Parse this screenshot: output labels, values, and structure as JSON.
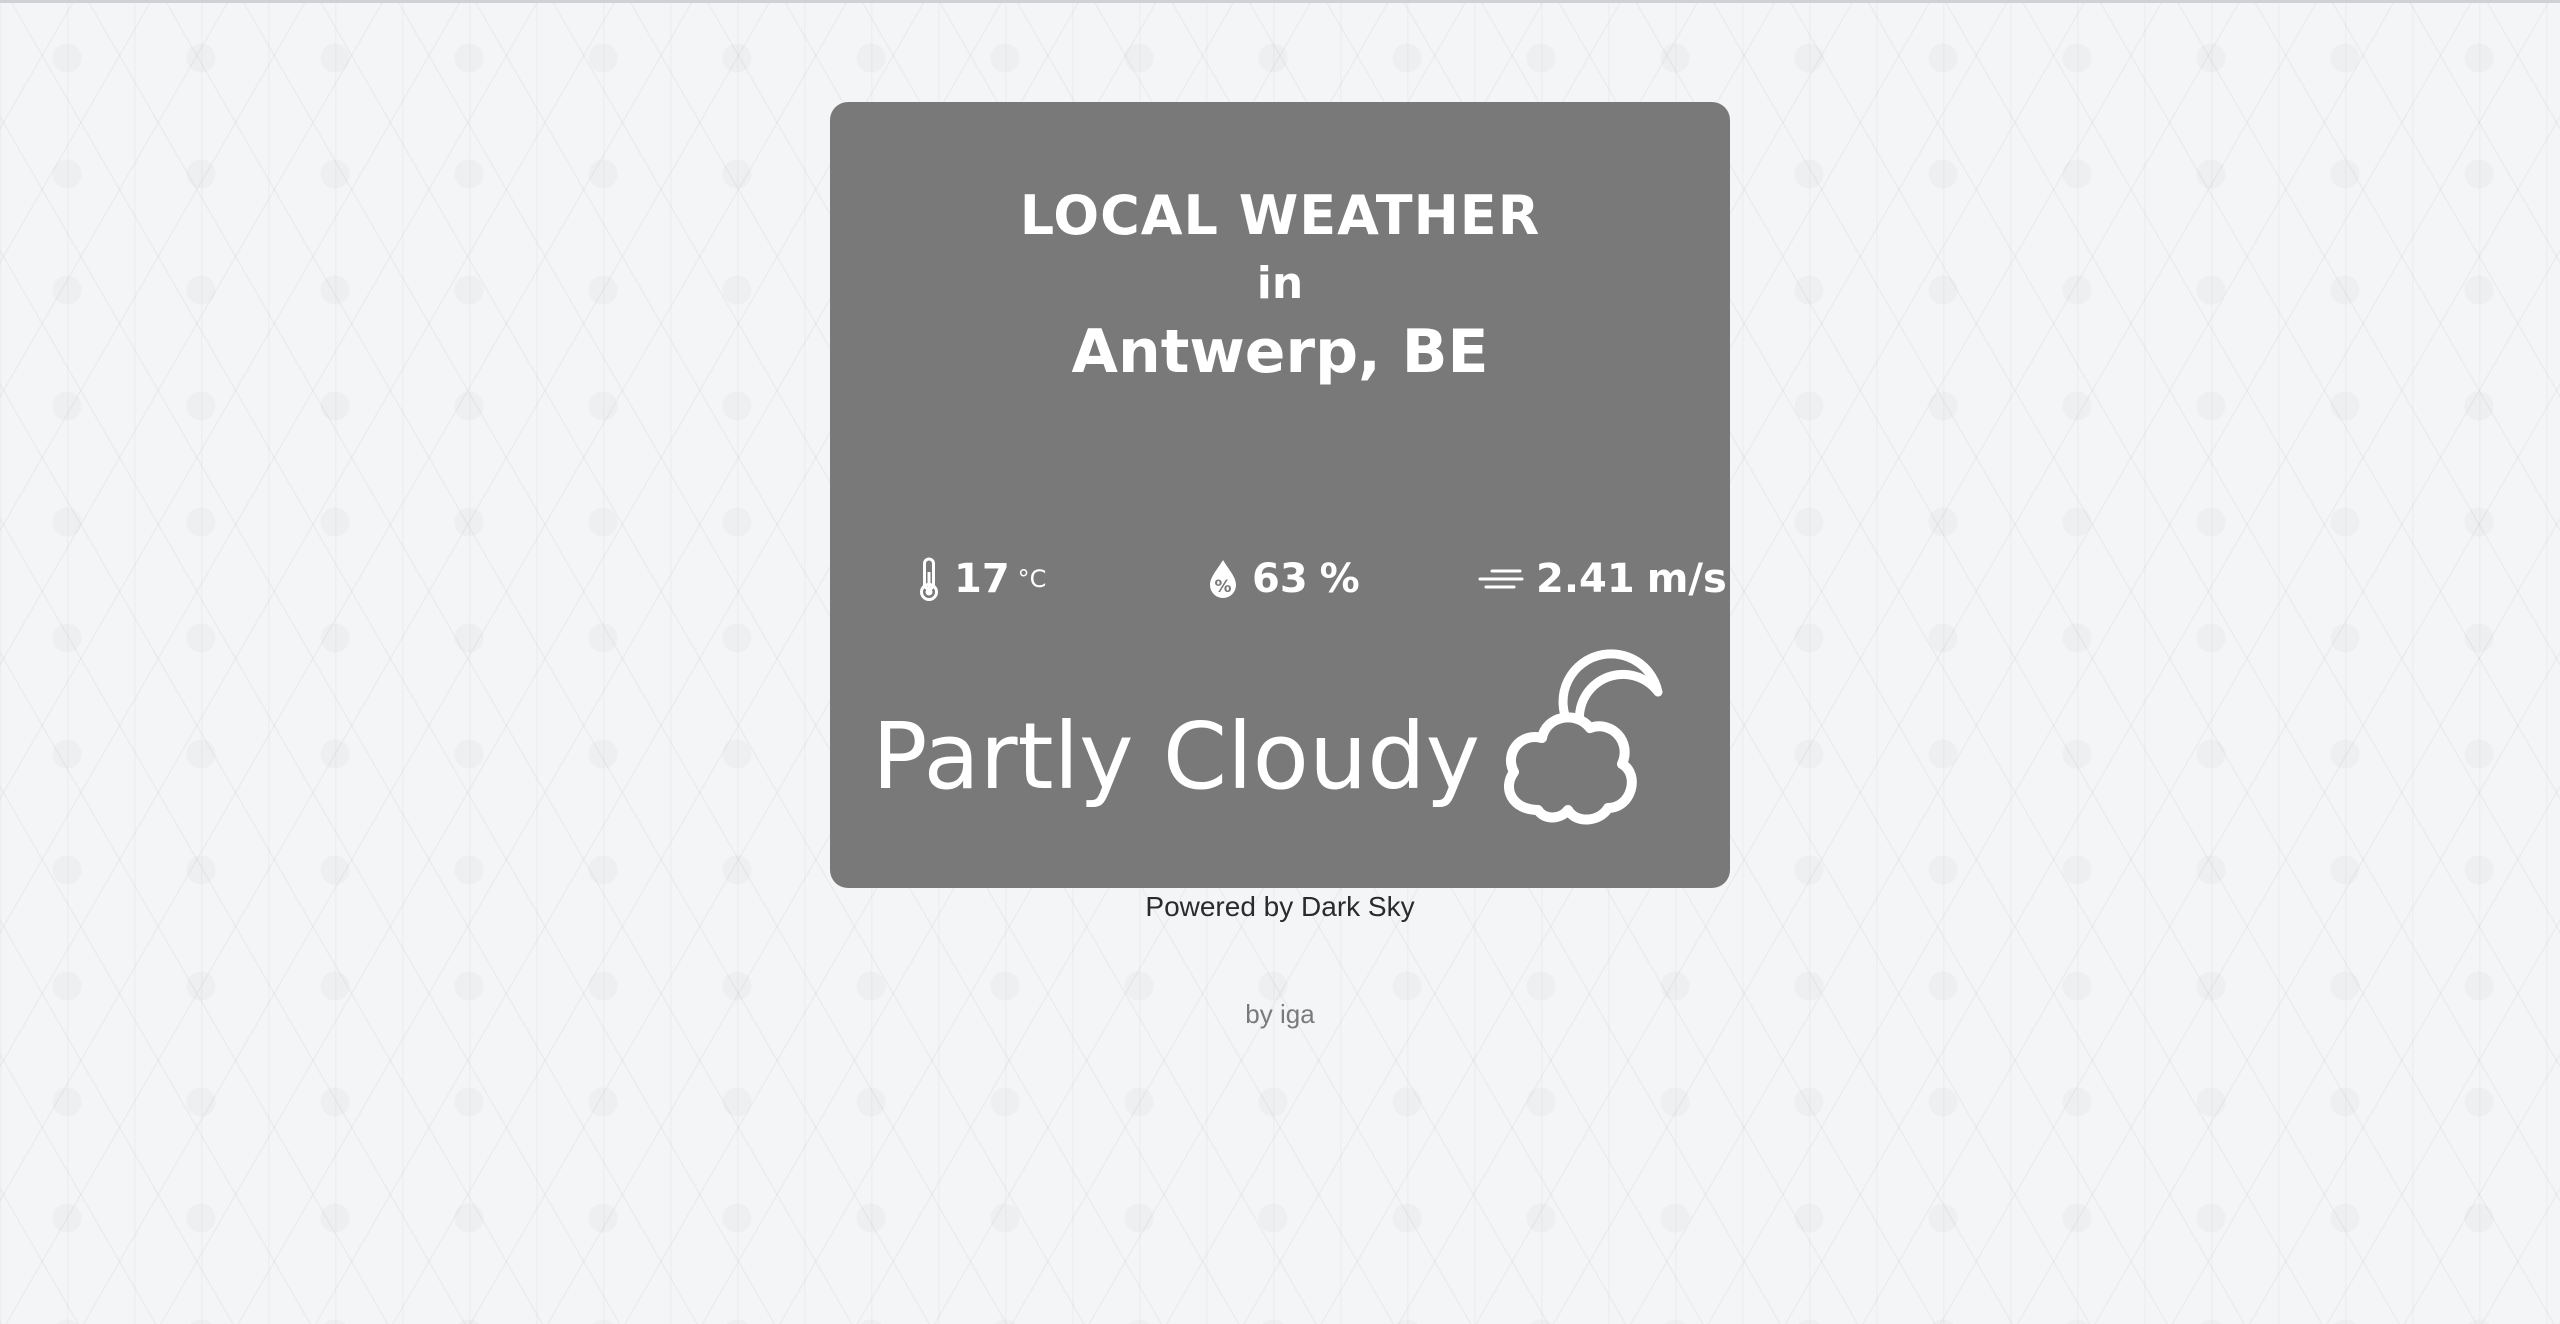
{
  "card": {
    "title_line1": "LOCAL WEATHER",
    "title_line2": "in",
    "location": "Antwerp, BE",
    "background_color": "#797979"
  },
  "stats": {
    "temperature": {
      "icon": "thermometer-icon",
      "value": "17",
      "unit": "°C"
    },
    "humidity": {
      "icon": "humidity-drop-icon",
      "value": "63",
      "unit": "%"
    },
    "wind": {
      "icon": "wind-icon",
      "value": "2.41",
      "unit": "m/s"
    }
  },
  "summary": {
    "text": "Partly Cloudy",
    "icon": "partly-cloudy-icon"
  },
  "footer": {
    "powered_by": "Powered by Dark Sky",
    "author": "by iga"
  }
}
